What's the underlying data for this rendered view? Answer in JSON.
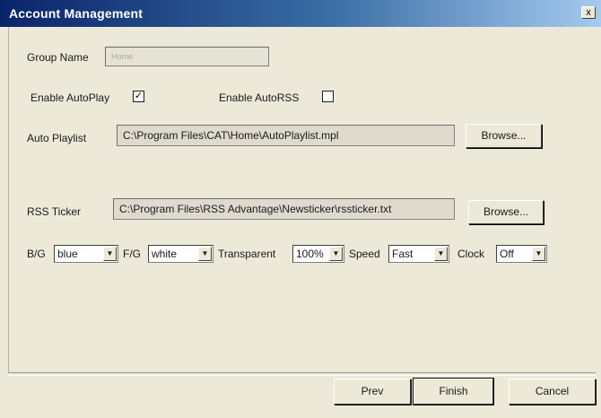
{
  "window": {
    "title": "Account Management",
    "close_glyph": "x"
  },
  "group": {
    "label": "Group Name",
    "value": "Home"
  },
  "autoplay": {
    "label": "Enable AutoPlay",
    "checked": true,
    "check_glyph": "✓"
  },
  "autorss": {
    "label": "Enable AutoRSS",
    "checked": false,
    "check_glyph": ""
  },
  "playlist": {
    "label": "Auto Playlist",
    "path": "C:\\Program Files\\CAT\\Home\\AutoPlaylist.mpl",
    "browse_label": "Browse..."
  },
  "rss": {
    "label": "RSS Ticker",
    "path": "C:\\Program Files\\RSS Advantage\\Newsticker\\rssticker.txt",
    "browse_label": "Browse..."
  },
  "options": {
    "bg": {
      "label": "B/G",
      "value": "blue"
    },
    "fg": {
      "label": "F/G",
      "value": "white"
    },
    "transparent": {
      "label": "Transparent",
      "value": "100%"
    },
    "speed": {
      "label": "Speed",
      "value": "Fast"
    },
    "clock": {
      "label": "Clock",
      "value": "Off"
    },
    "arrow_glyph": "▼"
  },
  "footer": {
    "prev_label": "Prev",
    "finish_label": "Finish",
    "cancel_label": "Cancel"
  }
}
